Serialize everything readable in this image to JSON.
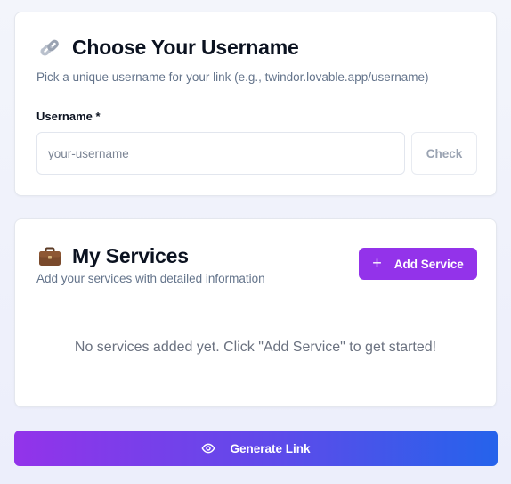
{
  "username_section": {
    "icon": "link-icon",
    "title": "Choose Your Username",
    "subtitle": "Pick a unique username for your link (e.g., twindor.lovable.app/username)",
    "field_label": "Username *",
    "input_value": "",
    "input_placeholder": "your-username",
    "check_label": "Check"
  },
  "services_section": {
    "icon": "briefcase-icon",
    "title": "My Services",
    "subtitle": "Add your services with detailed information",
    "add_button_icon": "plus-icon",
    "add_button_label": "Add Service",
    "empty_message": "No services added yet. Click \"Add Service\" to get started!"
  },
  "footer": {
    "generate_icon": "eye-icon",
    "generate_label": "Generate Link"
  },
  "colors": {
    "accent_purple": "#9333ea",
    "accent_blue": "#2563eb",
    "text_primary": "#0b1220",
    "text_muted": "#64748b",
    "page_background": "#eef1fa"
  }
}
